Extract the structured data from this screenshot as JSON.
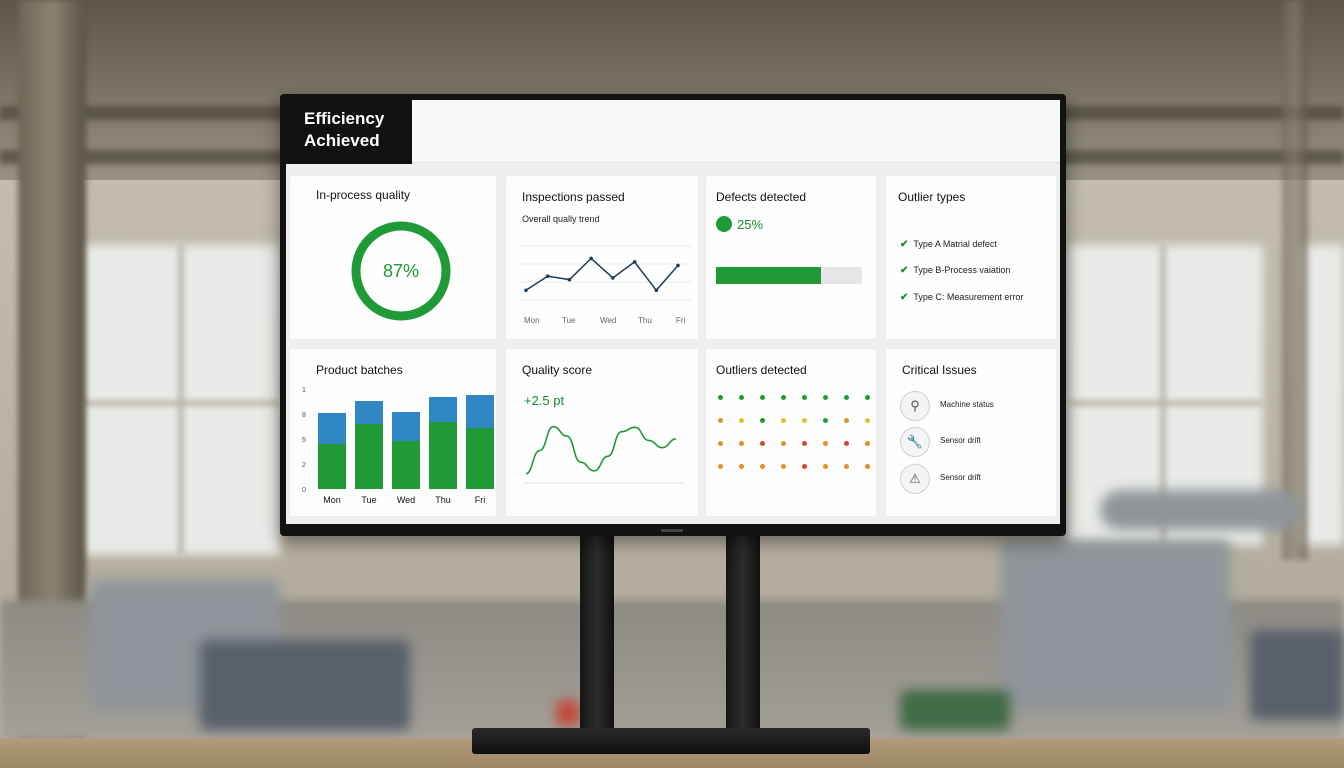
{
  "colors": {
    "accent_green": "#1f9a37",
    "bar_blue": "#2f88c4",
    "title_bg": "#111111",
    "warn_orange": "#e0912c",
    "error_red": "#d2492f",
    "yellow": "#d9c432"
  },
  "header": {
    "title_line1": "Efficiency",
    "title_line2": "Achieved"
  },
  "in_process_quality": {
    "title": "In-process quality",
    "value_label": "87%",
    "value": 87
  },
  "inspections_passed": {
    "title": "Inspections passed",
    "subtitle": "Overall qually trend",
    "chart_data": {
      "type": "line",
      "categories": [
        "Mon",
        "Tue",
        "Wed",
        "Thu",
        "Fri"
      ],
      "values": [
        2,
        3.6,
        3.2,
        5.6,
        3.4,
        5.2,
        2.0,
        4.8
      ]
    }
  },
  "defects_detected": {
    "title": "Defects detected",
    "value_label": "25%",
    "progress": 0.72
  },
  "outlier_types": {
    "title": "Outlier types",
    "items": [
      "Type A Matrial defect",
      "Type B-Process vaiation",
      "Type C: Measurement error"
    ],
    "icon": "check-icon"
  },
  "product_batches": {
    "title": "Product batches",
    "chart_data": {
      "type": "bar",
      "categories": [
        "Mon",
        "Tue",
        "Wed",
        "Thu",
        "Fri"
      ],
      "y_tick_labels": [
        "0",
        "2",
        "5",
        "8",
        "1"
      ],
      "ylim": [
        0,
        10
      ],
      "series": [
        {
          "values": [
            4.5,
            6.5,
            4.8,
            6.7,
            6.1
          ]
        },
        {
          "values": [
            3.1,
            2.3,
            2.9,
            2.5,
            3.3
          ]
        }
      ]
    }
  },
  "quality_score": {
    "title": "Quality score",
    "delta_label": "+2.5 pt",
    "chart_data": {
      "type": "line",
      "values": [
        1,
        4.2,
        7.5,
        6.2,
        2.6,
        1.4,
        3.4,
        6.8,
        7.4,
        5.6,
        4.6,
        5.8
      ]
    }
  },
  "outliers_detected": {
    "title": "Outliers detected",
    "grid": [
      [
        "green",
        "green",
        "green",
        "green",
        "green",
        "green",
        "green",
        "green"
      ],
      [
        "orange",
        "yellow",
        "green",
        "yellow",
        "yellow",
        "green",
        "orange",
        "yellow"
      ],
      [
        "orange",
        "orange",
        "red",
        "orange",
        "red",
        "orange",
        "red",
        "orange"
      ],
      [
        "orange",
        "orange",
        "orange",
        "orange",
        "red",
        "orange",
        "orange",
        "orange"
      ]
    ]
  },
  "critical_issues": {
    "title": "Critical Issues",
    "items": [
      {
        "icon": "location-pin-icon",
        "glyph": "⚲",
        "label": "Machine status"
      },
      {
        "icon": "wrench-icon",
        "glyph": "🔧",
        "label": "Sensor drift"
      },
      {
        "icon": "warning-icon",
        "glyph": "⚠",
        "label": "Sensor drift"
      }
    ]
  }
}
